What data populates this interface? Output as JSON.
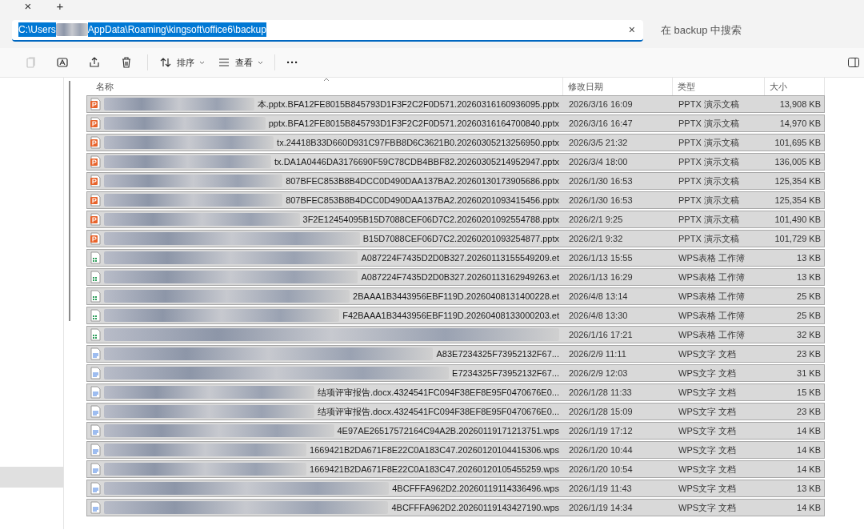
{
  "tabs": {
    "close": "×",
    "new": "+"
  },
  "address": {
    "segments": [
      "C:\\Users",
      "AppData\\Roaming\\kingsoft\\office6\\backup"
    ],
    "selected": true,
    "clear": "×"
  },
  "search": {
    "placeholder": "在 backup 中搜索"
  },
  "toolbar": [
    {
      "kind": "copy",
      "disabled": true
    },
    {
      "kind": "rename",
      "disabled": false
    },
    {
      "kind": "share",
      "disabled": false
    },
    {
      "kind": "delete",
      "disabled": false
    },
    {
      "kind": "sort",
      "label": "排序",
      "disabled": false
    },
    {
      "kind": "view",
      "label": "查看",
      "disabled": false
    },
    {
      "kind": "more",
      "label": "···",
      "disabled": false
    }
  ],
  "nav": {
    "items": [
      {
        "selected": true
      }
    ]
  },
  "table": {
    "columns": [
      "名称",
      "修改日期",
      "类型",
      "大小"
    ],
    "rows": [
      {
        "kind": "pptx",
        "selected": true,
        "name": "本.pptx.BFA12FE8015B845793D1F3F2C2F0D571.20260316160936095.pptx",
        "date": "2026/3/16 16:09",
        "type": "PPTX 演示文稿",
        "size": "13,908 KB"
      },
      {
        "kind": "pptx",
        "selected": true,
        "name": "pptx.BFA12FE8015B845793D1F3F2C2F0D571.20260316164700840.pptx",
        "date": "2026/3/16 16:47",
        "type": "PPTX 演示文稿",
        "size": "14,970 KB"
      },
      {
        "kind": "pptx",
        "selected": true,
        "name": "tx.24418B33D660D931C97FBB8D6C3621B0.20260305213256950.pptx",
        "date": "2026/3/5 21:32",
        "type": "PPTX 演示文稿",
        "size": "101,695 KB"
      },
      {
        "kind": "pptx",
        "selected": true,
        "name": "tx.DA1A0446DA3176690F59C78CDB4BBF82.20260305214952947.pptx",
        "date": "2026/3/4 18:00",
        "type": "PPTX 演示文稿",
        "size": "136,005 KB"
      },
      {
        "kind": "pptx",
        "selected": true,
        "name": "807BFEC853B8B4DCC0D490DAA137BA2.20260130173905686.pptx",
        "date": "2026/1/30 16:53",
        "type": "PPTX 演示文稿",
        "size": "125,354 KB"
      },
      {
        "kind": "pptx",
        "selected": true,
        "name": "807BFEC853B8B4DCC0D490DAA137BA2.20260201093415456.pptx",
        "date": "2026/1/30 16:53",
        "type": "PPTX 演示文稿",
        "size": "125,354 KB"
      },
      {
        "kind": "pptx",
        "selected": true,
        "name": "3F2E12454095B15D7088CEF06D7C2.20260201092554788.pptx",
        "date": "2026/2/1 9:25",
        "type": "PPTX 演示文稿",
        "size": "101,490 KB"
      },
      {
        "kind": "pptx",
        "selected": true,
        "name": "B15D7088CEF06D7C2.20260201093254877.pptx",
        "date": "2026/2/1 9:32",
        "type": "PPTX 演示文稿",
        "size": "101,729 KB"
      },
      {
        "kind": "et",
        "selected": true,
        "name": "A087224F7435D2D0B327.20260113155549209.et",
        "date": "2026/1/13 15:55",
        "type": "WPS表格 工作簿",
        "size": "13 KB"
      },
      {
        "kind": "et",
        "selected": true,
        "name": "A087224F7435D2D0B327.20260113162949263.et",
        "date": "2026/1/13 16:29",
        "type": "WPS表格 工作簿",
        "size": "13 KB"
      },
      {
        "kind": "et",
        "selected": true,
        "name": "2BAAA1B3443956EBF119D.20260408131400228.et",
        "date": "2026/4/8 13:14",
        "type": "WPS表格 工作簿",
        "size": "25 KB"
      },
      {
        "kind": "et",
        "selected": true,
        "name": "F42BAAA1B3443956EBF119D.20260408133000203.et",
        "date": "2026/4/8 13:30",
        "type": "WPS表格 工作簿",
        "size": "25 KB"
      },
      {
        "kind": "et",
        "selected": true,
        "date": "2026/1/16 17:21",
        "type": "WPS表格 工作簿",
        "size": "32 KB"
      },
      {
        "kind": "wps",
        "selected": true,
        "name": "A83E7234325F73952132F67...",
        "date": "2026/2/9 11:11",
        "type": "WPS文字 文档",
        "size": "23 KB"
      },
      {
        "kind": "wps",
        "selected": true,
        "name": "E7234325F73952132F67...",
        "date": "2026/2/9 12:03",
        "type": "WPS文字 文档",
        "size": "31 KB"
      },
      {
        "kind": "wps",
        "selected": true,
        "name": "结项评审报告.docx.4324541FC094F38EF8E95F0470676E0...",
        "date": "2026/1/28 11:33",
        "type": "WPS文字 文档",
        "size": "15 KB"
      },
      {
        "kind": "wps",
        "selected": true,
        "name": "结项评审报告.docx.4324541FC094F38EF8E95F0470676E0...",
        "date": "2026/1/28 15:09",
        "type": "WPS文字 文档",
        "size": "23 KB"
      },
      {
        "kind": "wps",
        "selected": true,
        "name": "4E97AE26517572164C94A2B.20260119171213751.wps",
        "date": "2026/1/19 17:12",
        "type": "WPS文字 文档",
        "size": "14 KB"
      },
      {
        "kind": "wps",
        "selected": true,
        "name": "1669421B2DA671F8E22C0A183C47.20260120104415306.wps",
        "date": "2026/1/20 10:44",
        "type": "WPS文字 文档",
        "size": "14 KB"
      },
      {
        "kind": "wps",
        "selected": true,
        "name": "1669421B2DA671F8E22C0A183C47.20260120105455259.wps",
        "date": "2026/1/20 10:54",
        "type": "WPS文字 文档",
        "size": "14 KB"
      },
      {
        "kind": "wps",
        "selected": true,
        "name": "4BCFFFA962D2.20260119114336496.wps",
        "date": "2026/1/19 11:43",
        "type": "WPS文字 文档",
        "size": "13 KB"
      },
      {
        "kind": "wps",
        "selected": true,
        "name": "4BCFFFA962D2.20260119143427190.wps",
        "date": "2026/1/19 14:34",
        "type": "WPS文字 文档",
        "size": "14 KB"
      }
    ]
  }
}
